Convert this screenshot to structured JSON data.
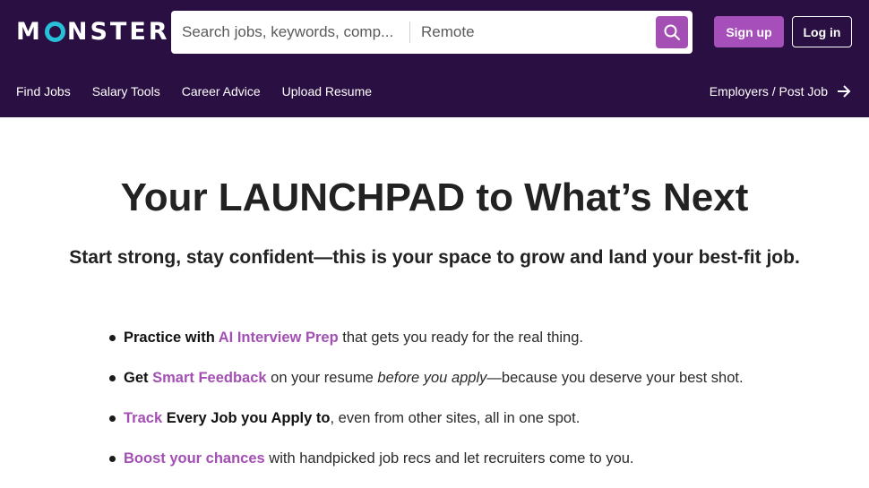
{
  "header": {
    "logo": {
      "pre": "M",
      "post": "NSTER",
      "ring_color": "#28bfd8"
    },
    "search": {
      "placeholder": "Search jobs, keywords, comp...",
      "location": "Remote",
      "icon": "search-icon"
    },
    "signup_label": "Sign up",
    "login_label": "Log in",
    "nav": [
      "Find Jobs",
      "Salary Tools",
      "Career Advice",
      "Upload Resume"
    ],
    "employers_label": "Employers / Post Job",
    "bg_color": "#2a0f43",
    "accent_color": "#a34fb4"
  },
  "hero": {
    "title": "Your LAUNCHPAD to What’s Next",
    "subtitle": "Start strong, stay confident—this is your space to grow and land your best-fit job."
  },
  "bullets": [
    {
      "a": "Practice with ",
      "link": "AI Interview Prep",
      "rest": " that gets you ready for the real thing."
    },
    {
      "a": "Get ",
      "link": "Smart Feedback",
      "mid": " on your resume ",
      "em": "before you apply",
      "rest": "—because you deserve your best shot."
    },
    {
      "link": "Track",
      "bold": " Every Job you Apply to",
      "rest": ", even from other sites, all in one spot."
    },
    {
      "link": "Boost your chances",
      "rest": " with handpicked job recs and let recruiters come to you."
    }
  ]
}
